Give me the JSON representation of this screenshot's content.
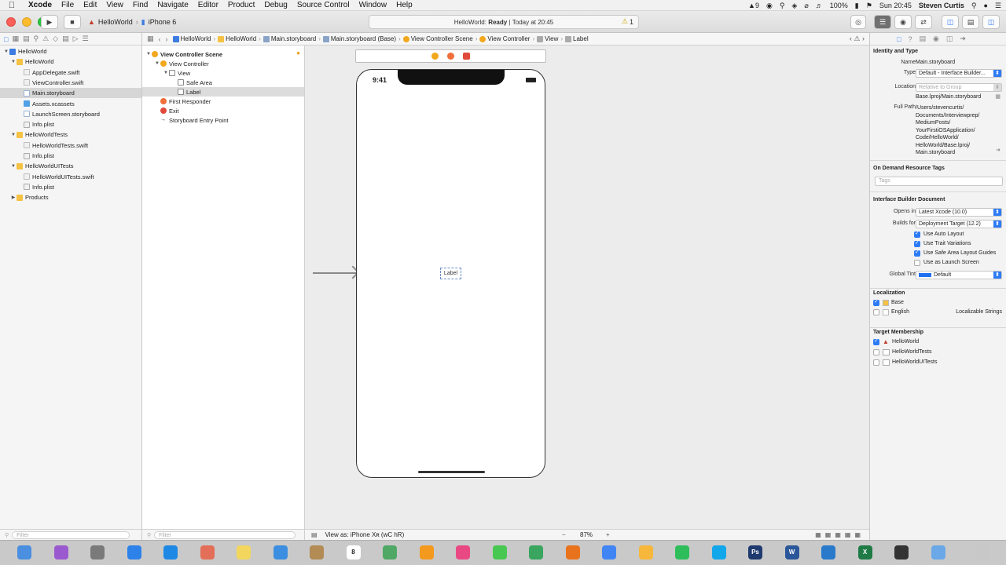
{
  "menubar": {
    "apple": "",
    "items": [
      "Xcode",
      "File",
      "Edit",
      "View",
      "Find",
      "Navigate",
      "Editor",
      "Product",
      "Debug",
      "Source Control",
      "Window",
      "Help"
    ],
    "status": {
      "adobe": "9",
      "battery": "100%",
      "clock": "Sun 20:45",
      "user": "Steven Curtis"
    }
  },
  "toolbar": {
    "scheme": "HelloWorld",
    "device": "iPhone 6",
    "activity_project": "HelloWorld:",
    "activity_status": "Ready",
    "activity_time": "Today at 20:45",
    "warning_count": "1"
  },
  "navigator": {
    "filter_placeholder": "Filter",
    "rows": [
      {
        "label": "HelloWorld",
        "icon": "project-icon",
        "depth": 0,
        "tri": "▼"
      },
      {
        "label": "HelloWorld",
        "icon": "folder-icon",
        "depth": 1,
        "tri": "▼"
      },
      {
        "label": "AppDelegate.swift",
        "icon": "swift-file-icon",
        "depth": 2,
        "tri": ""
      },
      {
        "label": "ViewController.swift",
        "icon": "swift-file-icon",
        "depth": 2,
        "tri": ""
      },
      {
        "label": "Main.storyboard",
        "icon": "storyboard-icon",
        "depth": 2,
        "tri": "",
        "selected": true
      },
      {
        "label": "Assets.xcassets",
        "icon": "assets-icon",
        "depth": 2,
        "tri": ""
      },
      {
        "label": "LaunchScreen.storyboard",
        "icon": "storyboard-icon",
        "depth": 2,
        "tri": ""
      },
      {
        "label": "Info.plist",
        "icon": "plist-icon",
        "depth": 2,
        "tri": ""
      },
      {
        "label": "HelloWorldTests",
        "icon": "folder-icon",
        "depth": 1,
        "tri": "▼"
      },
      {
        "label": "HelloWorldTests.swift",
        "icon": "swift-file-icon",
        "depth": 2,
        "tri": ""
      },
      {
        "label": "Info.plist",
        "icon": "plist-icon",
        "depth": 2,
        "tri": ""
      },
      {
        "label": "HelloWorldUITests",
        "icon": "folder-icon",
        "depth": 1,
        "tri": "▼"
      },
      {
        "label": "HelloWorldUITests.swift",
        "icon": "swift-file-icon",
        "depth": 2,
        "tri": ""
      },
      {
        "label": "Info.plist",
        "icon": "plist-icon",
        "depth": 2,
        "tri": ""
      },
      {
        "label": "Products",
        "icon": "folder-icon",
        "depth": 1,
        "tri": "▶"
      }
    ]
  },
  "jumpbar": {
    "crumbs": [
      "HelloWorld",
      "HelloWorld",
      "Main.storyboard",
      "Main.storyboard (Base)",
      "View Controller Scene",
      "View Controller",
      "View",
      "Label"
    ]
  },
  "outline": {
    "filter_placeholder": "Filter",
    "rows": [
      {
        "label": "View Controller Scene",
        "depth": 0,
        "tri": "▼",
        "bold": true
      },
      {
        "label": "View Controller",
        "depth": 1,
        "tri": "▼"
      },
      {
        "label": "View",
        "depth": 2,
        "tri": "▼"
      },
      {
        "label": "Safe Area",
        "depth": 3,
        "tri": ""
      },
      {
        "label": "Label",
        "depth": 3,
        "tri": "",
        "selected": true
      },
      {
        "label": "First Responder",
        "depth": 1,
        "tri": ""
      },
      {
        "label": "Exit",
        "depth": 1,
        "tri": ""
      },
      {
        "label": "Storyboard Entry Point",
        "depth": 1,
        "tri": ""
      }
    ]
  },
  "canvas": {
    "phone_time": "9:41",
    "label_text": "Label",
    "view_as": "View as: iPhone Xʀ (wC hR)",
    "zoom_minus": "−",
    "zoom": "87%",
    "zoom_plus": "+"
  },
  "inspector": {
    "identity_header": "Identity and Type",
    "name_label": "Name",
    "name_value": "Main.storyboard",
    "type_label": "Type",
    "type_value": "Default - Interface Builder...",
    "location_label": "Location",
    "location_value": "Relative to Group",
    "location_path": "Base.lproj/Main.storyboard",
    "fullpath_label": "Full Path",
    "fullpath_lines": [
      "/Users/stevencurtis/",
      "Documents/Interviewprep/",
      "MediumPosts/",
      "YourFirstiOSApplication/",
      "Code/HelloWorld/",
      "HelloWorld/Base.lproj/",
      "Main.storyboard"
    ],
    "odr_header": "On Demand Resource Tags",
    "tags_placeholder": "Tags",
    "ibdoc_header": "Interface Builder Document",
    "opens_in_label": "Opens in",
    "opens_in_value": "Latest Xcode (10.0)",
    "builds_for_label": "Builds for",
    "builds_for_value": "Deployment Target (12.2)",
    "checks": [
      {
        "label": "Use Auto Layout",
        "checked": true
      },
      {
        "label": "Use Trait Variations",
        "checked": true
      },
      {
        "label": "Use Safe Area Layout Guides",
        "checked": true
      },
      {
        "label": "Use as Launch Screen",
        "checked": false
      }
    ],
    "global_tint_label": "Global Tint",
    "global_tint_value": "Default",
    "tint_color": "#1f6ff0",
    "localization_header": "Localization",
    "loc_rows": [
      {
        "label": "Base",
        "checked": true,
        "extra": ""
      },
      {
        "label": "English",
        "checked": false,
        "extra": "Localizable Strings"
      }
    ],
    "target_header": "Target Membership",
    "targets": [
      {
        "label": "HelloWorld",
        "checked": true
      },
      {
        "label": "HelloWorldTests",
        "checked": false
      },
      {
        "label": "HelloWorldUITests",
        "checked": false
      }
    ]
  },
  "dock": {
    "apps": [
      "finder-icon",
      "siri-icon",
      "launchpad-icon",
      "safari-icon",
      "appstore-icon",
      "photos-icon",
      "notes-icon",
      "xcode-icon",
      "contacts-icon",
      "calendar-icon",
      "maps-icon",
      "vlc-icon",
      "itunes-icon",
      "messages-icon",
      "facetime-icon",
      "firefox-icon",
      "chrome-icon",
      "sketch-icon",
      "spotify-icon",
      "skype-icon",
      "photoshop-icon",
      "word-icon",
      "vscode-icon",
      "excel-icon",
      "terminal-icon",
      "folder-icon",
      "trash-icon"
    ],
    "colors": [
      "#4a8fe0",
      "#9b59d0",
      "#7a7a7a",
      "#2c82e8",
      "#1e88e5",
      "#e36f58",
      "#f2d65e",
      "#3c8fe0",
      "#b28b55",
      "#e84a3b",
      "#4fa865",
      "#f39a1e",
      "#e84983",
      "#48c852",
      "#3aa55f",
      "#e8731c",
      "#4185f4",
      "#f6b73c",
      "#2dbd5a",
      "#12a7ea",
      "#1e3a6e",
      "#2b579a",
      "#2a7acc",
      "#1f7a45",
      "#333333",
      "#6aa8e8",
      "#c8c8c8"
    ],
    "ps_label": "Ps",
    "word_label": "W",
    "excel_label": "X",
    "calendar_day": "8"
  }
}
